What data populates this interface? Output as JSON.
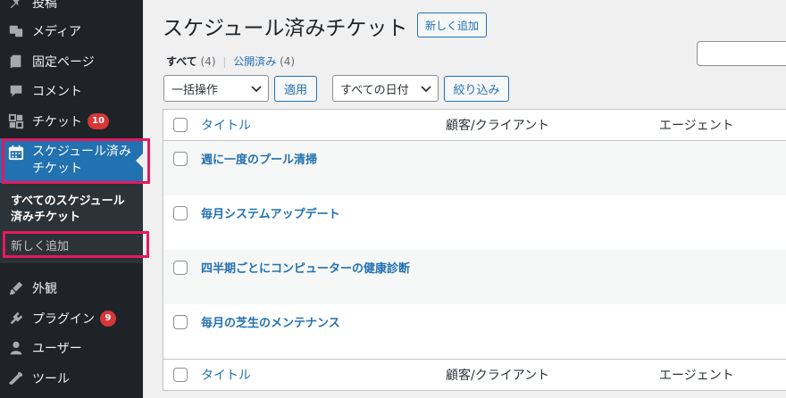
{
  "sidebar": {
    "items": [
      {
        "label": "投稿",
        "icon": "pin-icon"
      },
      {
        "label": "メディア",
        "icon": "media-icon"
      },
      {
        "label": "固定ページ",
        "icon": "page-icon"
      },
      {
        "label": "コメント",
        "icon": "comment-icon"
      },
      {
        "label": "チケット",
        "icon": "grid-icon",
        "badge": "10"
      },
      {
        "label": "外観",
        "icon": "brush-icon"
      },
      {
        "label": "プラグイン",
        "icon": "plugin-icon",
        "badge": "9"
      },
      {
        "label": "ユーザー",
        "icon": "user-icon"
      },
      {
        "label": "ツール",
        "icon": "wrench-icon"
      }
    ],
    "active": {
      "label_line1": "スケジュール済み",
      "label_line2": "チケット",
      "icon": "calendar-icon"
    },
    "submenu": {
      "current_line1": "すべてのスケジュール",
      "current_line2": "済みチケット",
      "add_new": "新しく追加"
    }
  },
  "header": {
    "title": "スケジュール済みチケット",
    "add_new": "新しく追加"
  },
  "filters": {
    "all_label": "すべて",
    "all_count": "(4)",
    "separator": "|",
    "published_label": "公開済み",
    "published_count": "(4)"
  },
  "toolbar": {
    "bulk_action": "一括操作",
    "apply": "適用",
    "date_filter": "すべての日付",
    "filter": "絞り込み"
  },
  "table": {
    "columns": {
      "title": "タイトル",
      "client": "顧客/クライアント",
      "agent": "エージェント"
    },
    "rows": [
      {
        "title": "週に一度のプール清掃"
      },
      {
        "title": "毎月システムアップデート"
      },
      {
        "title": "四半期ごとにコンピューターの健康診断"
      },
      {
        "title": "毎月の芝生のメンテナンス"
      }
    ]
  },
  "colors": {
    "accent": "#2271b1",
    "highlight": "#e6195f",
    "sidebar": "#1d2327",
    "badge": "#d63638"
  }
}
